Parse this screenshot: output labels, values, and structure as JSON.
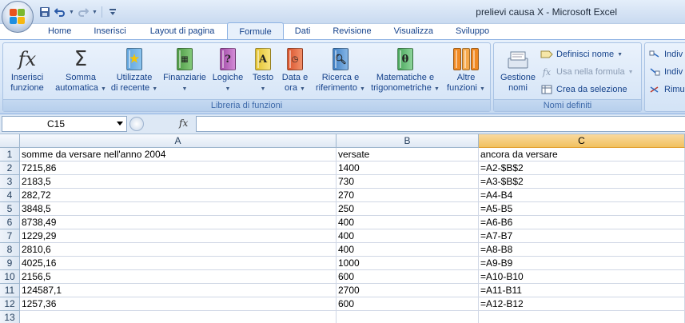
{
  "window": {
    "title": "prelievi causa X - Microsoft Excel"
  },
  "quick_access": {
    "icons": [
      "save-icon",
      "undo-icon",
      "redo-icon",
      "customize-icon"
    ]
  },
  "tabs": [
    "Home",
    "Inserisci",
    "Layout di pagina",
    "Formule",
    "Dati",
    "Revisione",
    "Visualizza",
    "Sviluppo"
  ],
  "active_tab": "Formule",
  "ribbon": {
    "library": {
      "label": "Libreria di funzioni",
      "insert_fn": [
        "Inserisci",
        "funzione"
      ],
      "autosum": [
        "Somma",
        "automatica"
      ],
      "recent": [
        "Utilizzate",
        "di recente"
      ],
      "financial": "Finanziarie",
      "logical": "Logiche",
      "text": "Testo",
      "datetime": [
        "Data e",
        "ora"
      ],
      "lookup": [
        "Ricerca e",
        "riferimento"
      ],
      "math": [
        "Matematiche e",
        "trigonometriche"
      ],
      "more": [
        "Altre",
        "funzioni"
      ]
    },
    "names": {
      "label": "Nomi definiti",
      "manager": [
        "Gestione",
        "nomi"
      ],
      "define": "Definisci nome",
      "use_in_formula": "Usa nella formula",
      "create_from_selection": "Crea da selezione"
    },
    "audit": {
      "trace_precedents": "Indiv",
      "trace_dependents": "Indiv",
      "remove_arrows": "Rimu"
    }
  },
  "formula_bar": {
    "name_box": "C15",
    "fx": "fx",
    "content": ""
  },
  "grid": {
    "columns": [
      "A",
      "B",
      "C"
    ],
    "selected_column": "C",
    "rows": [
      {
        "n": "1",
        "a": "somme da versare nell'anno 2004",
        "b": "versate",
        "c": "ancora da versare"
      },
      {
        "n": "2",
        "a": "7215,86",
        "b": "1400",
        "c": "=A2-$B$2"
      },
      {
        "n": "3",
        "a": "2183,5",
        "b": "730",
        "c": "=A3-$B$2"
      },
      {
        "n": "4",
        "a": "282,72",
        "b": "270",
        "c": "=A4-B4"
      },
      {
        "n": "5",
        "a": "3848,5",
        "b": "250",
        "c": "=A5-B5"
      },
      {
        "n": "6",
        "a": "8738,49",
        "b": "400",
        "c": "=A6-B6"
      },
      {
        "n": "7",
        "a": "1229,29",
        "b": "400",
        "c": "=A7-B7"
      },
      {
        "n": "8",
        "a": "2810,6",
        "b": "400",
        "c": "=A8-B8"
      },
      {
        "n": "9",
        "a": "4025,16",
        "b": "1000",
        "c": "=A9-B9"
      },
      {
        "n": "10",
        "a": "2156,5",
        "b": "600",
        "c": "=A10-B10"
      },
      {
        "n": "11",
        "a": "124587,1",
        "b": "2700",
        "c": "=A11-B11"
      },
      {
        "n": "12",
        "a": "1257,36",
        "b": "600",
        "c": "=A12-B12"
      },
      {
        "n": "13",
        "a": "",
        "b": "",
        "c": ""
      }
    ]
  }
}
